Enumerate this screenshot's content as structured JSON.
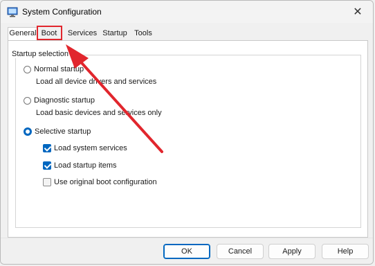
{
  "window": {
    "title": "System Configuration",
    "app_icon": "msconfig-icon",
    "close_glyph": "✕"
  },
  "tabs": [
    {
      "label": "General",
      "active": true
    },
    {
      "label": "Boot",
      "active": false,
      "highlighted": true
    },
    {
      "label": "Services",
      "active": false
    },
    {
      "label": "Startup",
      "active": false
    },
    {
      "label": "Tools",
      "active": false
    }
  ],
  "general": {
    "group_label": "Startup selection",
    "options": [
      {
        "label": "Normal startup",
        "description": "Load all device drivers and services",
        "selected": false
      },
      {
        "label": "Diagnostic startup",
        "description": "Load basic devices and services only",
        "selected": false
      },
      {
        "label": "Selective startup",
        "selected": true
      }
    ],
    "checks": [
      {
        "label": "Load system services",
        "checked": true
      },
      {
        "label": "Load startup items",
        "checked": true
      },
      {
        "label": "Use original boot configuration",
        "checked": false
      }
    ]
  },
  "buttons": {
    "ok": "OK",
    "cancel": "Cancel",
    "apply": "Apply",
    "help": "Help"
  },
  "colors": {
    "accent": "#0067c0",
    "annotation_red": "#e1262d"
  }
}
